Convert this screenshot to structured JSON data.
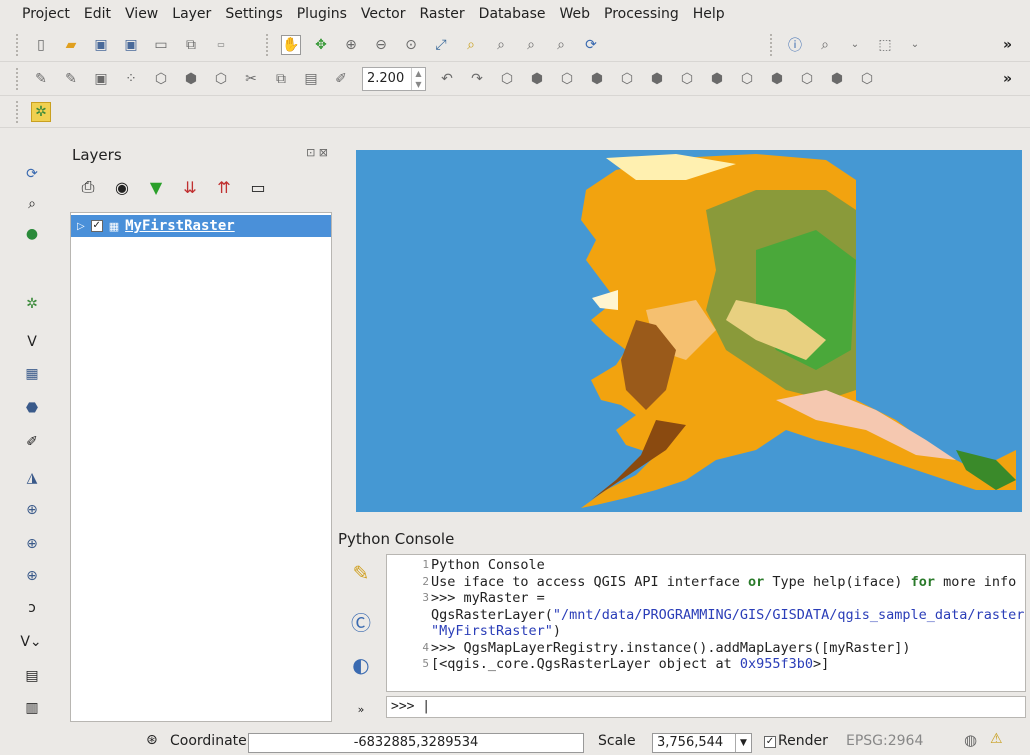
{
  "menu": [
    "Project",
    "Edit",
    "View",
    "Layer",
    "Settings",
    "Plugins",
    "Vector",
    "Raster",
    "Database",
    "Web",
    "Processing",
    "Help"
  ],
  "toolbar": {
    "spin_value": "2.200",
    "more_label": "»"
  },
  "layers_panel": {
    "title": "Layers",
    "float_icons": "⊡ ⊠",
    "layer": {
      "name": "MyFirstRaster",
      "checked": "✓"
    }
  },
  "console": {
    "title": "Python Console",
    "lines": [
      {
        "n": "1",
        "text": "Python Console"
      },
      {
        "n": "2",
        "pre": "Use iface to access QGIS API interface ",
        "kw1": "or",
        "mid": " Type help(iface) ",
        "kw2": "for",
        "post": " more info"
      },
      {
        "n": "3",
        "pre": ">>> myRaster = QgsRasterLayer(",
        "str": "\"/mnt/data/PROGRAMMING/GIS/GISDATA/qgis_sample_data/raster/landcover.img\", \"MyFirstRaster\"",
        "post": ")"
      },
      {
        "n": "4",
        "text": ">>> QgsMapLayerRegistry.instance().addMapLayers([myRaster])"
      },
      {
        "n": "5",
        "pre": "[<qgis._core.QgsRasterLayer object at ",
        "str": "0x955f3b0",
        "post": ">]"
      }
    ],
    "prompt": ">>> |"
  },
  "status": {
    "coord_label": "Coordinate:",
    "coord_value": "-6832885,3289534",
    "scale_label": "Scale",
    "scale_value": "3,756,544",
    "render_label": "Render",
    "render_checked": "✓",
    "crs": "EPSG:2964"
  }
}
